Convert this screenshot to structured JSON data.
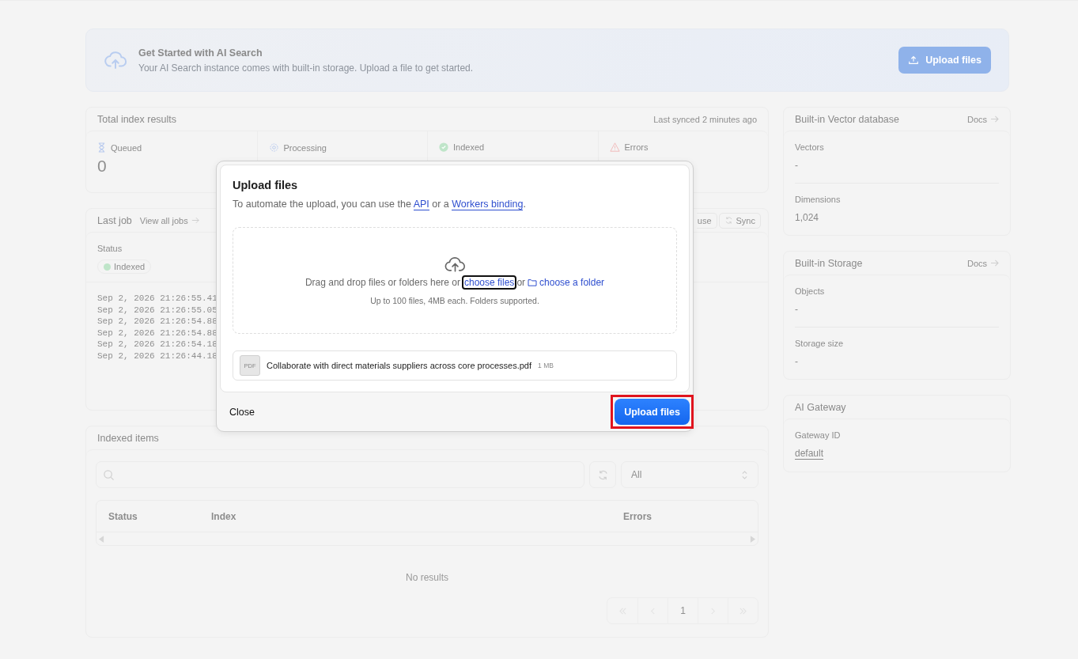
{
  "banner": {
    "title": "Get Started with AI Search",
    "text": "Your AI Search instance comes with built-in storage. Upload a file to get started.",
    "button": "Upload files"
  },
  "index_results": {
    "title": "Total index results",
    "synced": "Last synced 2 minutes ago",
    "stats": [
      {
        "kind": "queued",
        "label": "Queued",
        "value": "0"
      },
      {
        "kind": "processing",
        "label": "Processing"
      },
      {
        "kind": "indexed",
        "label": "Indexed"
      },
      {
        "kind": "errors",
        "label": "Errors"
      }
    ]
  },
  "last_job": {
    "title": "Last job",
    "link": "View all jobs",
    "buttons": [
      {
        "kind": "plain",
        "label": "use"
      },
      {
        "kind": "sync",
        "label": "Sync"
      }
    ],
    "status_label": "Status",
    "status": "Indexed",
    "logs": [
      "Sep 2, 2026 21:26:55.41",
      "Sep 2, 2026 21:26:55.05",
      "Sep 2, 2026 21:26:54.88",
      "Sep 2, 2026 21:26:54.88",
      "Sep 2, 2026 21:26:54.18",
      "Sep 2, 2026 21:26:44.18"
    ]
  },
  "indexed_items": {
    "title": "Indexed items",
    "filter": "All",
    "columns": [
      "Status",
      "Index",
      "Errors"
    ],
    "empty": "No results",
    "page": "1"
  },
  "side": [
    {
      "title": "Built-in Vector database",
      "docs": "Docs",
      "fields": [
        {
          "label": "Vectors",
          "value": "-"
        },
        {
          "label": "Dimensions",
          "value": "1,024"
        }
      ]
    },
    {
      "title": "Built-in Storage",
      "docs": "Docs",
      "fields": [
        {
          "label": "Objects",
          "value": "-"
        },
        {
          "label": "Storage size",
          "value": "-"
        }
      ]
    },
    {
      "title": "AI Gateway",
      "fields": [
        {
          "label": "Gateway ID",
          "value": "default",
          "kind": "link"
        }
      ]
    }
  ],
  "modal": {
    "title": "Upload files",
    "intro_pre": "To automate the upload, you can use the",
    "api_link": "API",
    "intro_mid": "or a",
    "binding_link": "Workers binding",
    "intro_post": ".",
    "drop_text": "Drag and drop files or folders here or",
    "choose_files": "choose files",
    "or": "or",
    "choose_folder": "choose a folder",
    "limits": "Up to 100 files, 4MB each. Folders supported.",
    "file": {
      "type": "PDF",
      "name": "Collaborate with direct materials suppliers across core processes.pdf",
      "size": "1 MB"
    },
    "close": "Close",
    "submit": "Upload files"
  }
}
